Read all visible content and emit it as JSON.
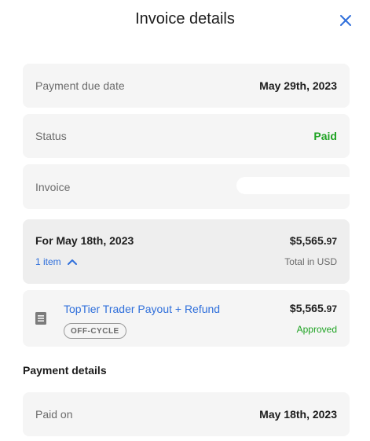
{
  "header": {
    "title": "Invoice details",
    "close_icon": "close-icon"
  },
  "details": {
    "due_date_label": "Payment due date",
    "due_date_value": "May 29th, 2023",
    "status_label": "Status",
    "status_value": "Paid",
    "invoice_label": "Invoice"
  },
  "summary": {
    "date_label": "For May 18th, 2023",
    "amount_main": "$5,565.",
    "amount_cents": "97",
    "items_count": "1 item",
    "total_note": "Total in USD"
  },
  "line_item": {
    "name": "TopTier Trader Payout + Refund",
    "badge": "OFF-CYCLE",
    "amount_main": "$5,565.",
    "amount_cents": "97",
    "status": "Approved",
    "icon": "document-icon"
  },
  "payment_details": {
    "section_title": "Payment details",
    "paid_on_label": "Paid on",
    "paid_on_value": "May 18th, 2023"
  },
  "colors": {
    "accent_blue": "#2f6fdb",
    "success_green": "#1fa323"
  }
}
